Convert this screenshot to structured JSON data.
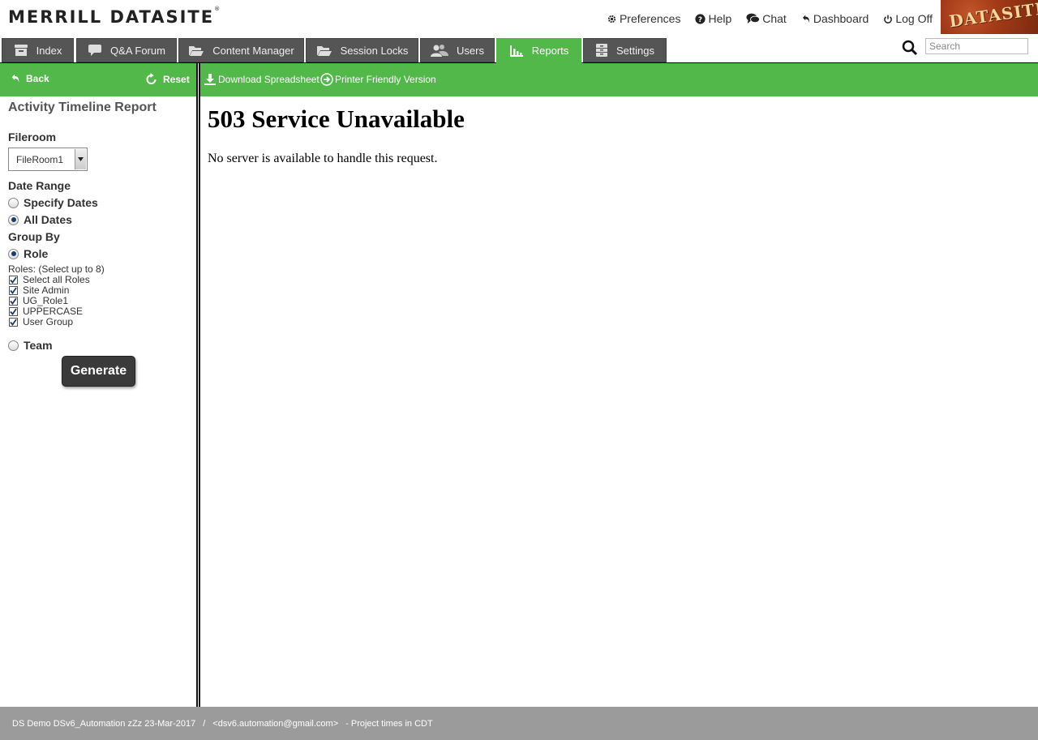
{
  "header": {
    "logo": "MERRILL DATASITE",
    "trademark": "®",
    "brand_image_text": "DATASITE",
    "links": [
      {
        "label": "Preferences",
        "icon": "gear-icon"
      },
      {
        "label": "Help",
        "icon": "help-icon"
      },
      {
        "label": "Chat",
        "icon": "chat-icon"
      },
      {
        "label": "Dashboard",
        "icon": "return-arrow-icon"
      },
      {
        "label": "Log Off",
        "icon": "power-icon"
      }
    ]
  },
  "tabs": [
    {
      "label": "Index",
      "icon": "archive-box-icon"
    },
    {
      "label": "Q&A Forum",
      "icon": "speech-bubble-icon"
    },
    {
      "label": "Content Manager",
      "icon": "folder-open-icon"
    },
    {
      "label": "Session Locks",
      "icon": "folder-open-icon"
    },
    {
      "label": "Users",
      "icon": "users-icon"
    },
    {
      "label": "Reports",
      "icon": "bar-chart-icon",
      "active": true
    },
    {
      "label": "Settings",
      "icon": "file-cabinet-icon"
    }
  ],
  "search": {
    "placeholder": "Search"
  },
  "toolbar": {
    "back": "Back",
    "reset": "Reset",
    "download": "Download Spreadsheet",
    "printer": "Printer Friendly Version"
  },
  "left_panel": {
    "title": "Activity Timeline Report",
    "fileroom_label": "Fileroom",
    "fileroom_value": "FileRoom1",
    "date_range_label": "Date Range",
    "specify_dates": "Specify Dates",
    "all_dates": "All Dates",
    "date_range_selected": "All Dates",
    "group_by_label": "Group By",
    "role": "Role",
    "group_by_selected": "Role",
    "roles_label": "Roles: (Select up to 8)",
    "roles": [
      {
        "label": "Select all Roles",
        "checked": true
      },
      {
        "label": "Site Admin",
        "checked": true
      },
      {
        "label": "UG_Role1",
        "checked": true
      },
      {
        "label": "UPPERCASE",
        "checked": true
      },
      {
        "label": "User Group",
        "checked": true
      }
    ],
    "team": "Team",
    "generate": "Generate"
  },
  "main": {
    "error_title": "503 Service Unavailable",
    "error_message": "No server is available to handle this request."
  },
  "footer": {
    "project": "DS Demo DSv6_Automation zZz 23-Mar-2017",
    "separator": "/",
    "email": "<dsv6.automation@gmail.com>",
    "note": "- Project times in CDT"
  },
  "colors": {
    "accent_green": "#52b84a",
    "tab_gray": "#555555",
    "footer_gray": "#9b9b9b"
  }
}
